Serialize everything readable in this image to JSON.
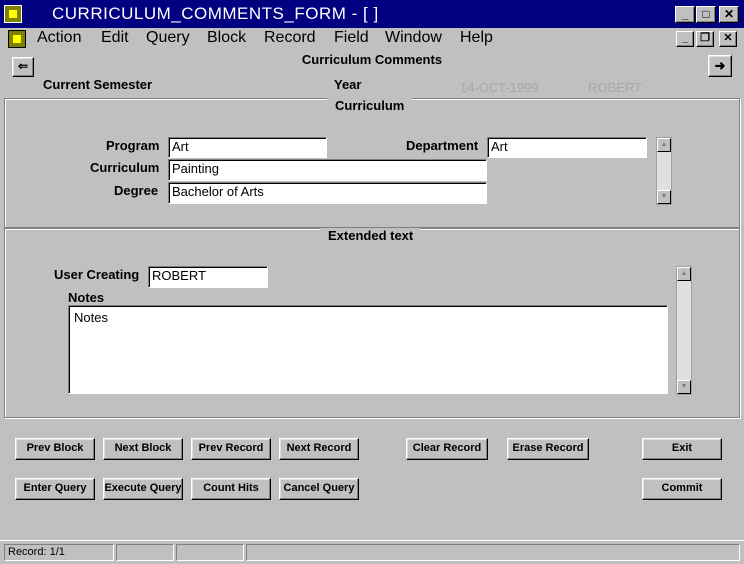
{
  "window": {
    "title": "CURRICULUM_COMMENTS_FORM - [ ]",
    "minimize_label": "_",
    "maximize_label": "□",
    "close_label": "✕"
  },
  "menu": {
    "items": [
      "Action",
      "Edit",
      "Query",
      "Block",
      "Record",
      "Field",
      "Window",
      "Help"
    ],
    "mdi_minimize_label": "_",
    "mdi_restore_label": "❐",
    "mdi_close_label": "✕"
  },
  "header": {
    "form_title": "Curriculum Comments",
    "prev_arrow": "⇐",
    "next_arrow": "➜",
    "current_semester_label": "Current Semester",
    "year_label": "Year",
    "date": "14-OCT-1999",
    "user": "ROBERT"
  },
  "curriculum": {
    "section_title": "Curriculum",
    "program_label": "Program",
    "program_value": "Art",
    "department_label": "Department",
    "department_value": "Art",
    "curriculum_label": "Curriculum",
    "curriculum_value": "Painting",
    "degree_label": "Degree",
    "degree_value": "Bachelor of Arts"
  },
  "extended": {
    "section_title": "Extended text",
    "user_creating_label": "User Creating",
    "user_creating_value": "ROBERT",
    "notes_label": "Notes",
    "notes_value": "Notes"
  },
  "buttons": {
    "prev_block": "Prev Block",
    "next_block": "Next Block",
    "prev_record": "Prev Record",
    "next_record": "Next Record",
    "clear_record": "Clear Record",
    "erase_record": "Erase Record",
    "exit": "Exit",
    "enter_query": "Enter Query",
    "execute_query": "Execute Query",
    "count_hits": "Count Hits",
    "cancel_query": "Cancel Query",
    "commit": "Commit"
  },
  "status": {
    "record": "Record: 1/1"
  },
  "icons": {
    "app": "oracle-forms-icon",
    "scroll_up": "scroll-up-icon",
    "scroll_down": "scroll-down-icon"
  }
}
